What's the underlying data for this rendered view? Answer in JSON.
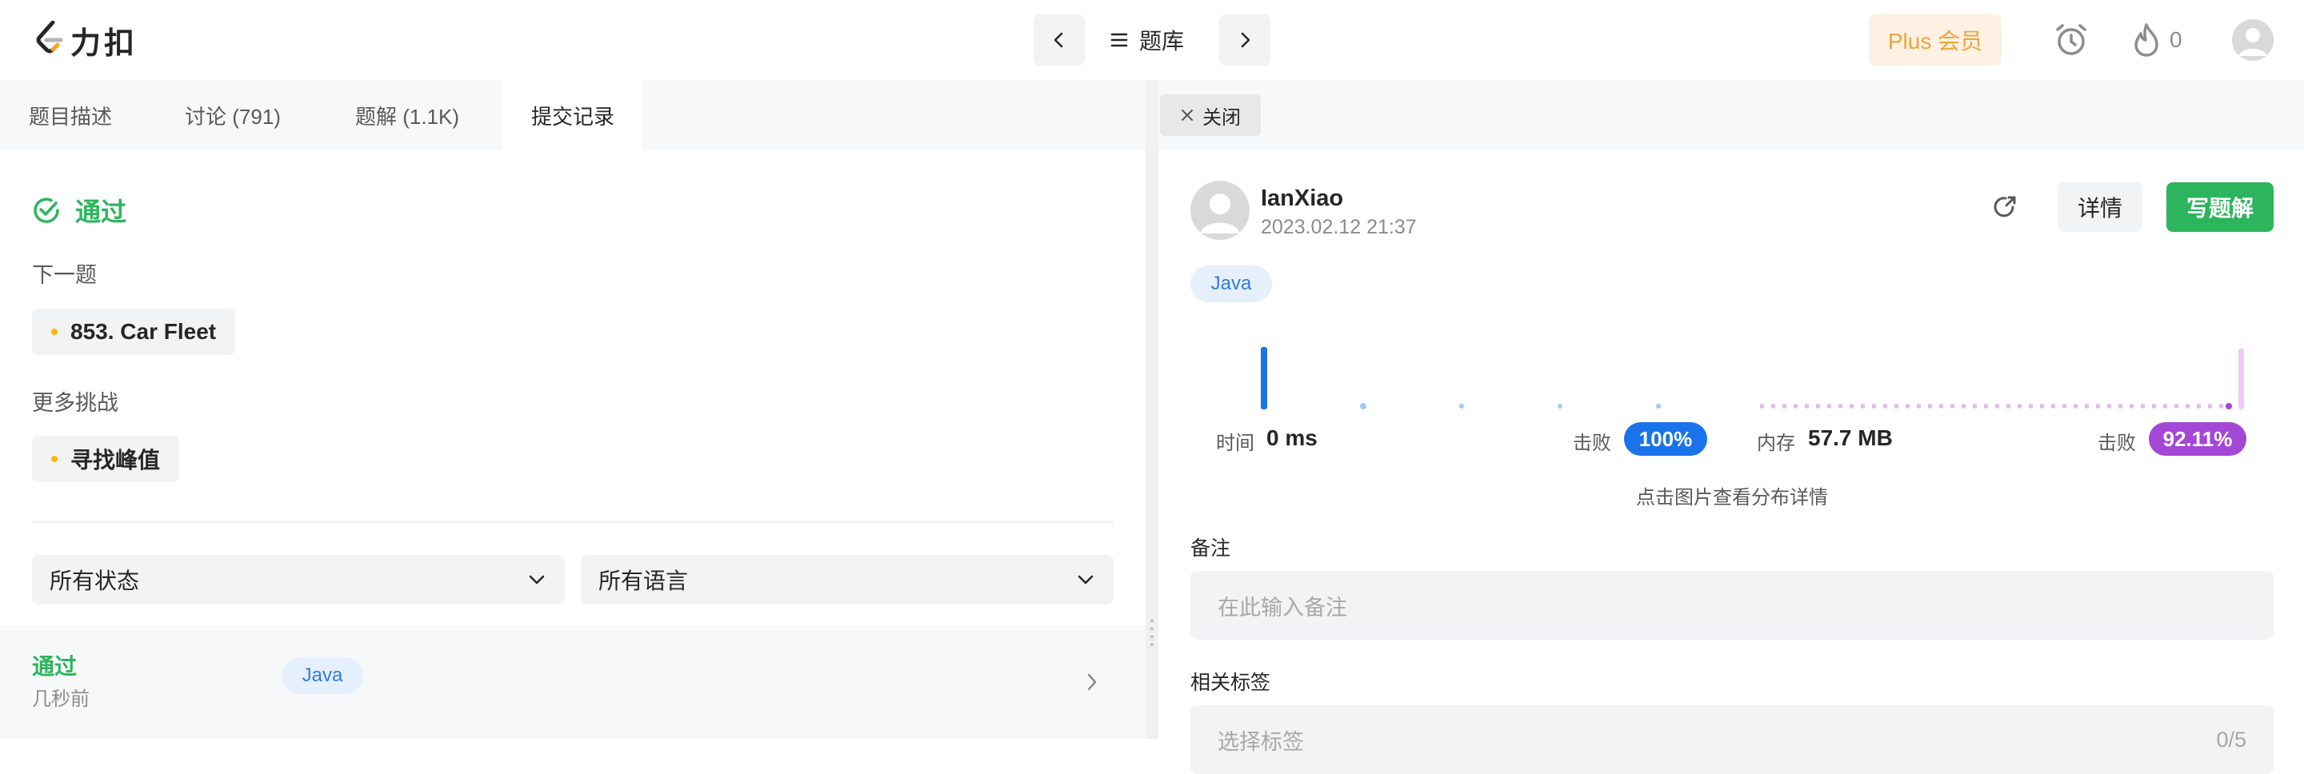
{
  "header": {
    "logo_text": "力扣",
    "problem_bank_label": "题库",
    "plus_label": "Plus 会员",
    "streak_count": "0"
  },
  "left_tabs": [
    {
      "label": "题目描述"
    },
    {
      "label": "讨论 (791)"
    },
    {
      "label": "题解 (1.1K)"
    },
    {
      "label": "提交记录"
    }
  ],
  "result": {
    "status": "通过",
    "next_label": "下一题",
    "next_problem": "853. Car Fleet",
    "more_label": "更多挑战",
    "more_problem": "寻找峰值"
  },
  "filters": {
    "status_select": "所有状态",
    "language_select": "所有语言"
  },
  "submission_row": {
    "status": "通过",
    "time": "几秒前",
    "language": "Java"
  },
  "right": {
    "close_label": "关闭",
    "username": "IanXiao",
    "timestamp": "2023.02.12 21:37",
    "detail_label": "详情",
    "write_solution_label": "写题解",
    "language": "Java",
    "time_label": "时间",
    "time_value": "0 ms",
    "beat_label_1": "击败",
    "time_beat": "100%",
    "memory_label": "内存",
    "memory_value": "57.7 MB",
    "beat_label_2": "击败",
    "memory_beat": "92.11%",
    "chart_hint": "点击图片查看分布详情",
    "note_label": "备注",
    "note_placeholder": "在此输入备注",
    "tags_label": "相关标签",
    "tags_placeholder": "选择标签",
    "tags_count": "0/5"
  },
  "colors": {
    "accent_green": "#2db55d",
    "time_blue": "#1a73e8",
    "memory_purple": "#a347d6",
    "plus_orange": "#f2a33a"
  }
}
